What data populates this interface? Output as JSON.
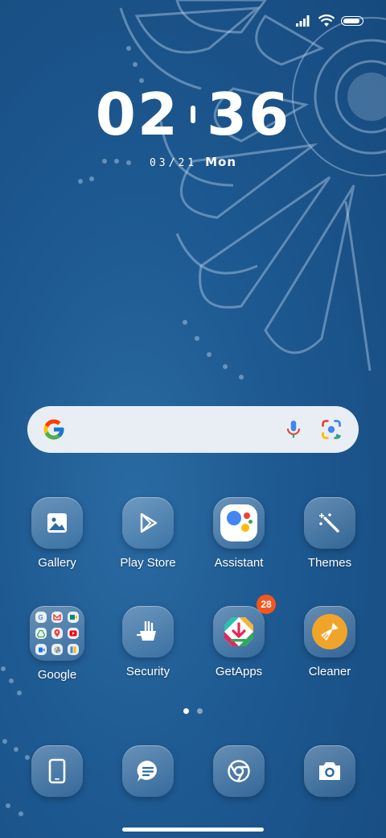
{
  "clock": {
    "hours": "02",
    "minutes": "36"
  },
  "date": {
    "numeric": "03/21",
    "weekday": "Mon"
  },
  "status_bar": {
    "icons": [
      "signal-icon",
      "wifi-icon",
      "battery-icon"
    ],
    "battery_level": 1.0
  },
  "search_widget": {
    "icons": [
      "google-logo-icon",
      "microphone-icon",
      "google-lens-icon"
    ]
  },
  "apps": [
    {
      "label": "Gallery",
      "icon": "gallery-icon"
    },
    {
      "label": "Play Store",
      "icon": "play-store-icon"
    },
    {
      "label": "Assistant",
      "icon": "assistant-icon"
    },
    {
      "label": "Themes",
      "icon": "magic-wand-icon"
    },
    {
      "label": "Google",
      "icon": "folder-icon"
    },
    {
      "label": "Security",
      "icon": "security-broom-icon"
    },
    {
      "label": "GetApps",
      "icon": "getapps-icon",
      "badge": "28"
    },
    {
      "label": "Cleaner",
      "icon": "cleaner-brush-icon"
    }
  ],
  "dock": [
    {
      "icon": "phone-icon"
    },
    {
      "icon": "messages-icon"
    },
    {
      "icon": "chrome-icon"
    },
    {
      "icon": "camera-icon"
    }
  ],
  "pagination": {
    "page_count": 2,
    "current_page": 1
  },
  "colors": {
    "wallpaper": "#1d5890",
    "badge": "#f3561f",
    "search_bg": "#e9eef5"
  }
}
